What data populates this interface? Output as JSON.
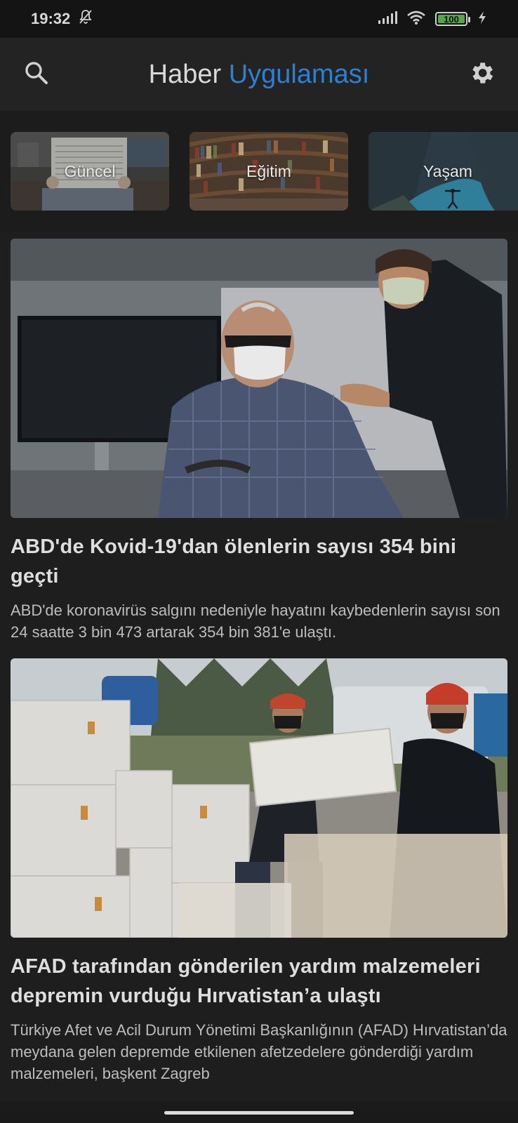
{
  "status_bar": {
    "time": "19:32",
    "battery_level": "100",
    "icons": [
      "notifications-off-icon",
      "signal-icon",
      "wifi-icon",
      "battery-icon",
      "charging-icon"
    ]
  },
  "app_bar": {
    "title_part1": "Haber",
    "title_part2": "Uygulaması",
    "accent_color": "#2d7fd1",
    "icons": [
      "search-icon",
      "settings-gear-icon"
    ]
  },
  "categories": [
    {
      "label": "Güncel"
    },
    {
      "label": "Eğitim"
    },
    {
      "label": "Yaşam"
    }
  ],
  "articles": [
    {
      "title": "ABD'de Kovid-19'dan ölenlerin sayısı 354 bini geçti",
      "summary": "ABD'de koronavirüs salgını nedeniyle hayatını kaybedenlerin sayısı son 24 saatte 3 bin 473 artarak 354 bin 381'e ulaştı."
    },
    {
      "title": "AFAD tarafından gönderilen yardım malzemeleri depremin vurduğu Hırvatistan’a ulaştı",
      "summary": "Türkiye Afet ve Acil Durum Yönetimi Başkanlığının (AFAD) Hırvatistan’da meydana gelen depremde etkilenen afetzedelere gönderdiği yardım malzemeleri, başkent Zagreb"
    }
  ]
}
